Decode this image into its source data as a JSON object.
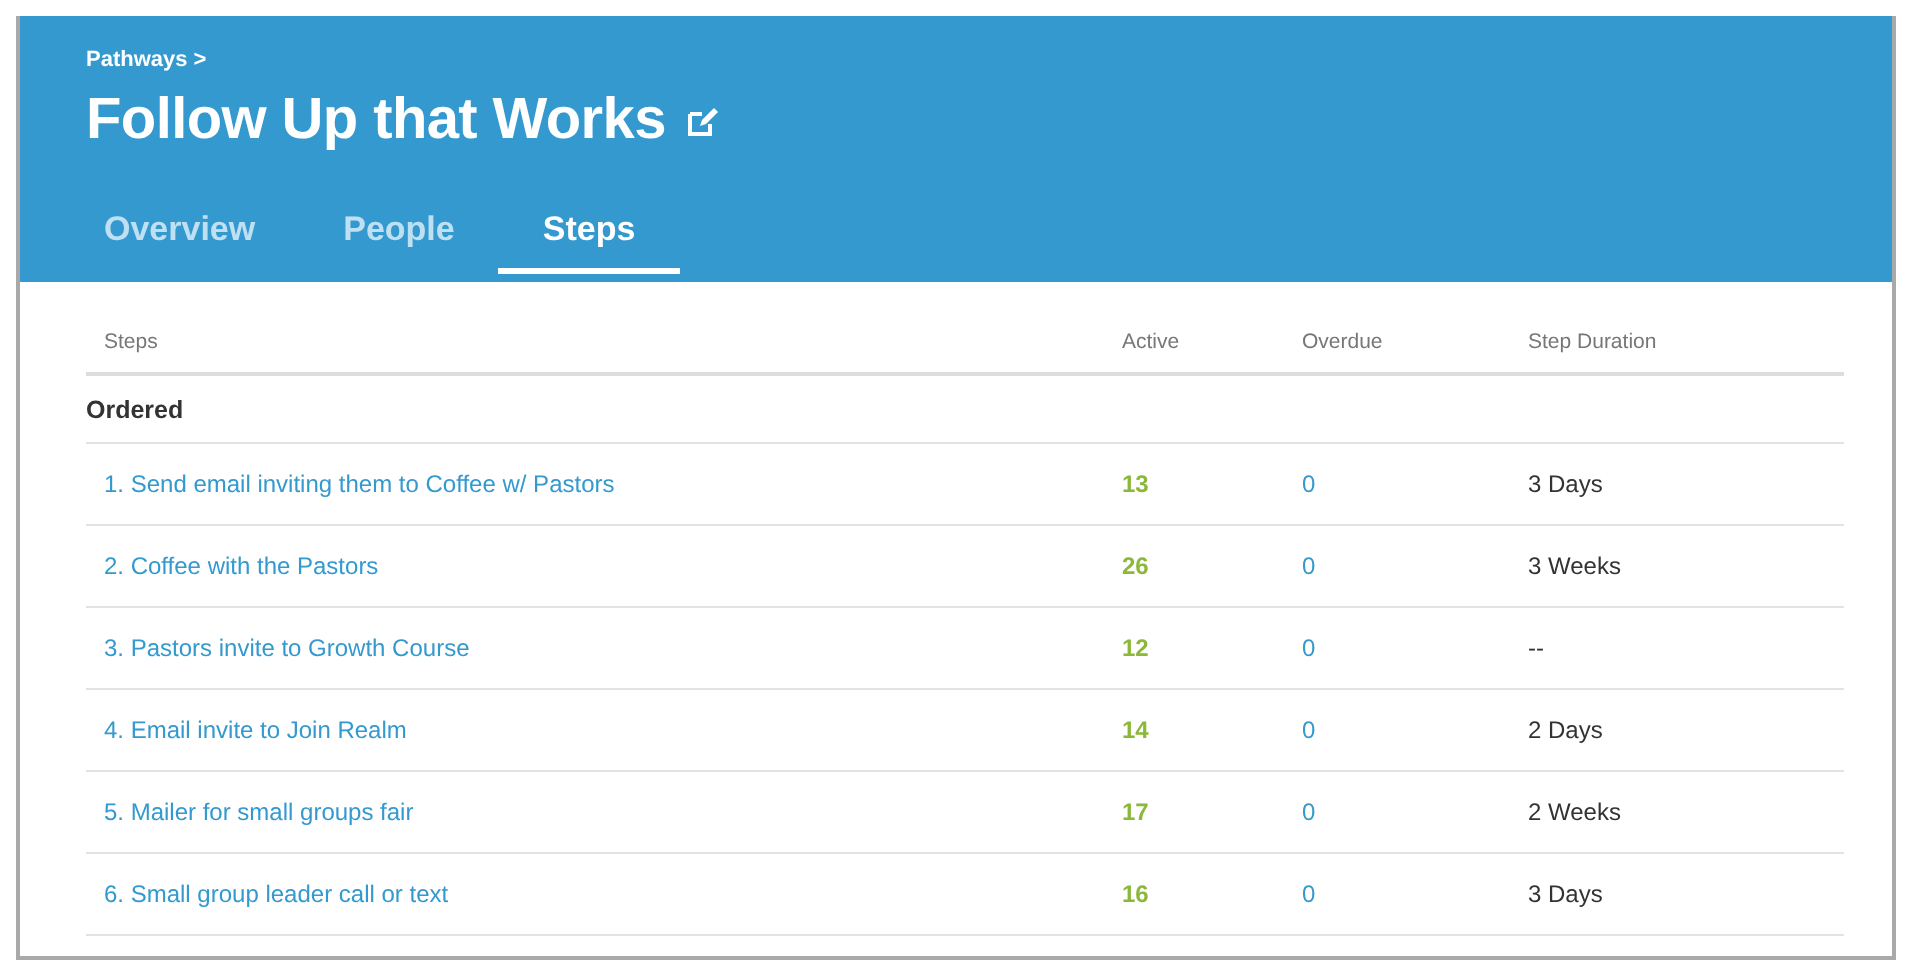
{
  "breadcrumb": "Pathways >",
  "title": "Follow Up that Works",
  "tabs": [
    {
      "label": "Overview",
      "selected": false
    },
    {
      "label": "People",
      "selected": false
    },
    {
      "label": "Steps",
      "selected": true
    }
  ],
  "table": {
    "columns": [
      "Steps",
      "Active",
      "Overdue",
      "Step Duration"
    ],
    "group": "Ordered",
    "rows": [
      {
        "step": "1. Send email inviting them to Coffee w/ Pastors",
        "active": "13",
        "overdue": "0",
        "duration": "3 Days"
      },
      {
        "step": "2. Coffee with the Pastors",
        "active": "26",
        "overdue": "0",
        "duration": "3 Weeks"
      },
      {
        "step": "3. Pastors invite to Growth Course",
        "active": "12",
        "overdue": "0",
        "duration": "--"
      },
      {
        "step": "4. Email invite to Join Realm",
        "active": "14",
        "overdue": "0",
        "duration": "2 Days"
      },
      {
        "step": "5. Mailer for small groups fair",
        "active": "17",
        "overdue": "0",
        "duration": "2 Weeks"
      },
      {
        "step": "6. Small group leader call or text",
        "active": "16",
        "overdue": "0",
        "duration": "3 Days"
      }
    ]
  }
}
